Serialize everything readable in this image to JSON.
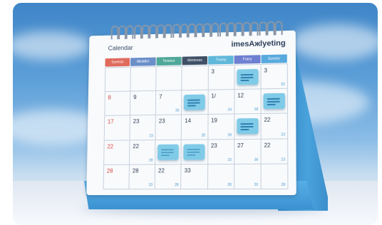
{
  "calendar": {
    "title_left": "Calendar",
    "title_right": "imesΑжlyeting",
    "weekdays": [
      {
        "label": "Sunesis",
        "color": "#e06a5c"
      },
      {
        "label": "Meddlor",
        "color": "#6b8fc9"
      },
      {
        "label": "Tenesur",
        "color": "#4fa89a"
      },
      {
        "label": "Wertenes",
        "color": "#3f4f66"
      },
      {
        "label": "Trsuny",
        "color": "#5fb7d9"
      },
      {
        "label": "Frany",
        "color": "#6f7fd1"
      },
      {
        "label": "Sunsey",
        "color": "#58a9dd"
      }
    ],
    "rows": [
      [
        {
          "d": "",
          "s": ""
        },
        {
          "d": "",
          "s": ""
        },
        {
          "d": "",
          "s": ""
        },
        {
          "d": "",
          "s": ""
        },
        {
          "d": "3",
          "s": ""
        },
        {
          "d": "",
          "s": "",
          "note": true
        },
        {
          "d": "3",
          "s": "32"
        }
      ],
      [
        {
          "d": "8",
          "s": "",
          "red": true
        },
        {
          "d": "9",
          "s": ""
        },
        {
          "d": "7",
          "s": "26"
        },
        {
          "d": "",
          "s": "",
          "note": true
        },
        {
          "d": "1/",
          "s": "24"
        },
        {
          "d": "12",
          "s": "28"
        },
        {
          "d": "",
          "s": "",
          "note": true
        }
      ],
      [
        {
          "d": "17",
          "s": "",
          "red": true
        },
        {
          "d": "23",
          "s": "23"
        },
        {
          "d": "23",
          "s": ""
        },
        {
          "d": "14",
          "s": "28"
        },
        {
          "d": "19",
          "s": "28"
        },
        {
          "d": "",
          "s": "",
          "note": true
        },
        {
          "d": "22",
          "s": "23"
        }
      ],
      [
        {
          "d": "22",
          "s": "",
          "red": true
        },
        {
          "d": "22",
          "s": "28"
        },
        {
          "d": "",
          "s": "",
          "note": true
        },
        {
          "d": "",
          "s": "",
          "note": true
        },
        {
          "d": "23",
          "s": "23"
        },
        {
          "d": "27",
          "s": "36"
        },
        {
          "d": "22",
          "s": "23"
        }
      ],
      [
        {
          "d": "28",
          "s": "",
          "red": true
        },
        {
          "d": "28",
          "s": "23"
        },
        {
          "d": "22",
          "s": "28"
        },
        {
          "d": "33",
          "s": ""
        },
        {
          "d": "",
          "s": "28"
        },
        {
          "d": "",
          "s": "20"
        },
        {
          "d": "",
          "s": "28"
        }
      ]
    ]
  }
}
